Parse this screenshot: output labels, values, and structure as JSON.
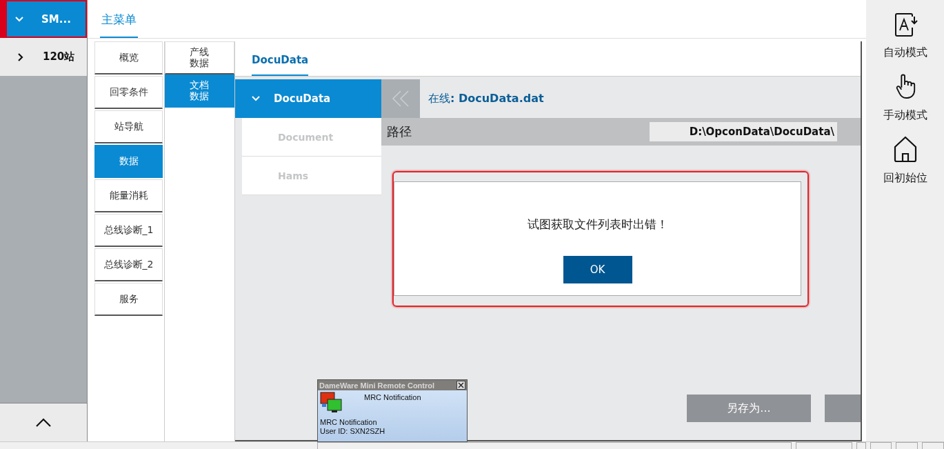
{
  "nav": {
    "items": [
      {
        "label": "SM...",
        "expanded": true,
        "selected": true
      },
      {
        "label": "120站",
        "expanded": false,
        "selected": false
      }
    ]
  },
  "main_tab": {
    "label": "主菜单",
    "selected": true
  },
  "menu": [
    {
      "label": "概览",
      "selected": false
    },
    {
      "label": "回零条件",
      "selected": false
    },
    {
      "label": "站导航",
      "selected": false
    },
    {
      "label": "数据",
      "selected": true
    },
    {
      "label": "能量消耗",
      "selected": false
    },
    {
      "label": "总线诊断_1",
      "selected": false
    },
    {
      "label": "总线诊断_2",
      "selected": false
    },
    {
      "label": "服务",
      "selected": false
    }
  ],
  "submenu": [
    {
      "label": "产线数据",
      "selected": false
    },
    {
      "label": "文档数据",
      "selected": true
    }
  ],
  "panel": {
    "tab": {
      "label": "DocuData",
      "selected": true
    },
    "tree_header": {
      "label": "DocuData",
      "expanded": true
    },
    "tree_items": [
      {
        "label": "Document",
        "disabled": true
      },
      {
        "label": "Hams",
        "disabled": true
      }
    ],
    "file": "在线**: DocuData.dat**",
    "path_label": "路径",
    "path_value": "D:\\OpconData\\DocuData\\",
    "buttons": [
      {
        "label": "另存为...",
        "disabled": true
      },
      {
        "disabled": true
      }
    ]
  },
  "dialog": {
    "message": "试图获取文件列表时出错！",
    "button": "OK",
    "highlighted": true
  },
  "modes": [
    {
      "label": "自动模式",
      "kind": "auto"
    },
    {
      "label": "手动模式",
      "kind": "manual"
    },
    {
      "label": "回初始位",
      "kind": "home"
    }
  ],
  "notification": {
    "title": "DameWare Mini Remote Control",
    "heading": "MRC Notification",
    "lines": [
      "MRC Notification",
      "User ID: SXN2SZH"
    ]
  }
}
